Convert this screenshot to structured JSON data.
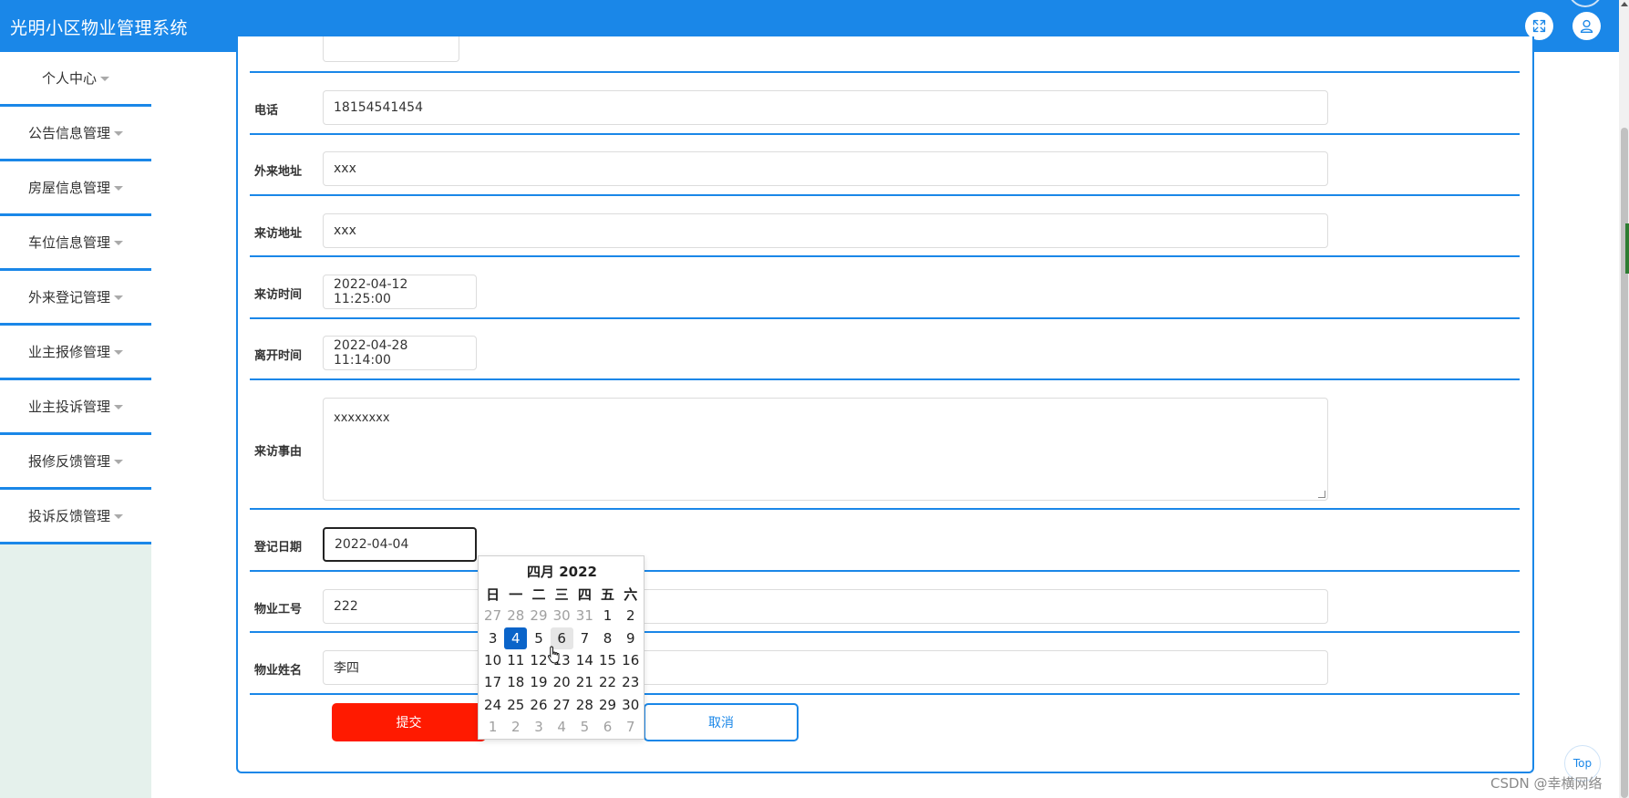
{
  "header": {
    "title": "光明小区物业管理系统",
    "expand_icon": "expand-icon",
    "user_icon": "user-icon",
    "colors": {
      "primary": "#1a87e8",
      "submit": "#ff1a00"
    }
  },
  "sidebar": {
    "items": [
      {
        "label": "个人中心"
      },
      {
        "label": "公告信息管理"
      },
      {
        "label": "房屋信息管理"
      },
      {
        "label": "车位信息管理"
      },
      {
        "label": "外来登记管理"
      },
      {
        "label": "业主报修管理"
      },
      {
        "label": "业主投诉管理"
      },
      {
        "label": "报修反馈管理"
      },
      {
        "label": "投诉反馈管理"
      }
    ]
  },
  "form": {
    "phone": {
      "label": "电话",
      "value": "18154541454"
    },
    "visitor_address": {
      "label": "外来地址",
      "value": "xxx"
    },
    "visit_address": {
      "label": "来访地址",
      "value": "xxx"
    },
    "visit_time": {
      "label": "来访时间",
      "value": "2022-04-12 11:25:00"
    },
    "leave_time": {
      "label": "离开时间",
      "value": "2022-04-28 11:14:00"
    },
    "visit_reason": {
      "label": "来访事由",
      "value": "xxxxxxxx"
    },
    "register_date": {
      "label": "登记日期",
      "value": "2022-04-04"
    },
    "staff_id": {
      "label": "物业工号",
      "value": "222"
    },
    "staff_name": {
      "label": "物业姓名",
      "value": "李四"
    },
    "submit_label": "提交",
    "cancel_label": "取消"
  },
  "datepicker": {
    "title": "四月 2022",
    "weekdays": [
      "日",
      "一",
      "二",
      "三",
      "四",
      "五",
      "六"
    ],
    "weeks": [
      [
        "27",
        "28",
        "29",
        "30",
        "31",
        "1",
        "2"
      ],
      [
        "3",
        "4",
        "5",
        "6",
        "7",
        "8",
        "9"
      ],
      [
        "10",
        "11",
        "12",
        "13",
        "14",
        "15",
        "16"
      ],
      [
        "17",
        "18",
        "19",
        "20",
        "21",
        "22",
        "23"
      ],
      [
        "24",
        "25",
        "26",
        "27",
        "28",
        "29",
        "30"
      ],
      [
        "1",
        "2",
        "3",
        "4",
        "5",
        "6",
        "7"
      ]
    ],
    "selected": "4",
    "hovered": "6"
  },
  "misc": {
    "top_label": "Top",
    "watermark": "CSDN @幸横网络"
  }
}
